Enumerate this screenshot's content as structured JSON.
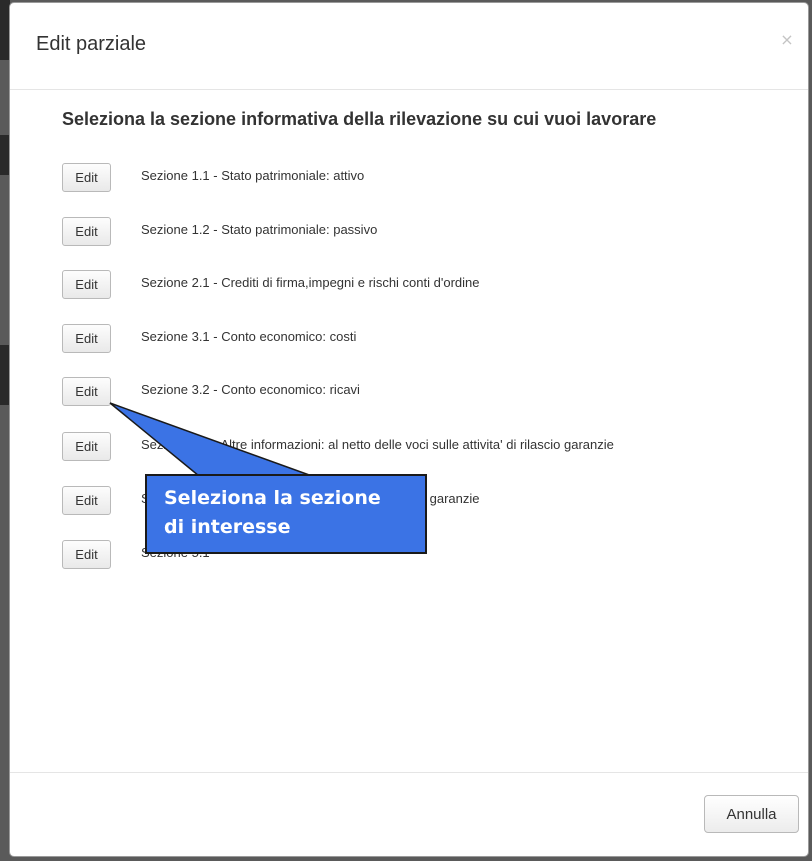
{
  "modal": {
    "title": "Edit parziale",
    "close_symbol": "×",
    "heading": "Seleziona la sezione informativa della rilevazione su cui vuoi lavorare",
    "edit_label": "Edit",
    "sections": [
      {
        "edit_label": "Edit",
        "label": "Sezione 1.1 - Stato patrimoniale: attivo"
      },
      {
        "edit_label": "Edit",
        "label": "Sezione 1.2 - Stato patrimoniale: passivo"
      },
      {
        "edit_label": "Edit",
        "label": "Sezione 2.1 - Crediti di firma,impegni e rischi conti d'ordine"
      },
      {
        "edit_label": "Edit",
        "label": "Sezione 3.1 - Conto economico: costi"
      },
      {
        "edit_label": "Edit",
        "label": "Sezione 3.2 - Conto economico: ricavi"
      },
      {
        "edit_label": "Edit",
        "label": "Sezione 4.1 - Altre informazioni: al netto delle voci sulle attivita' di rilascio garanzie"
      },
      {
        "edit_label": "Edit",
        "label": "Sezione 4.2 - Altre informazioni: attivita' di rilascio garanzie"
      },
      {
        "edit_label": "Edit",
        "label": "Sezione 5.1"
      }
    ],
    "footer": {
      "cancel_label": "Annulla"
    }
  },
  "callout": {
    "line1": "Seleziona la sezione",
    "line2": "di interesse",
    "fill_color": "#3b73e5",
    "text_color": "#ffffff"
  },
  "colors": {
    "backdrop": "#5a5a5a",
    "modal_background": "#ffffff",
    "text": "#333333"
  }
}
